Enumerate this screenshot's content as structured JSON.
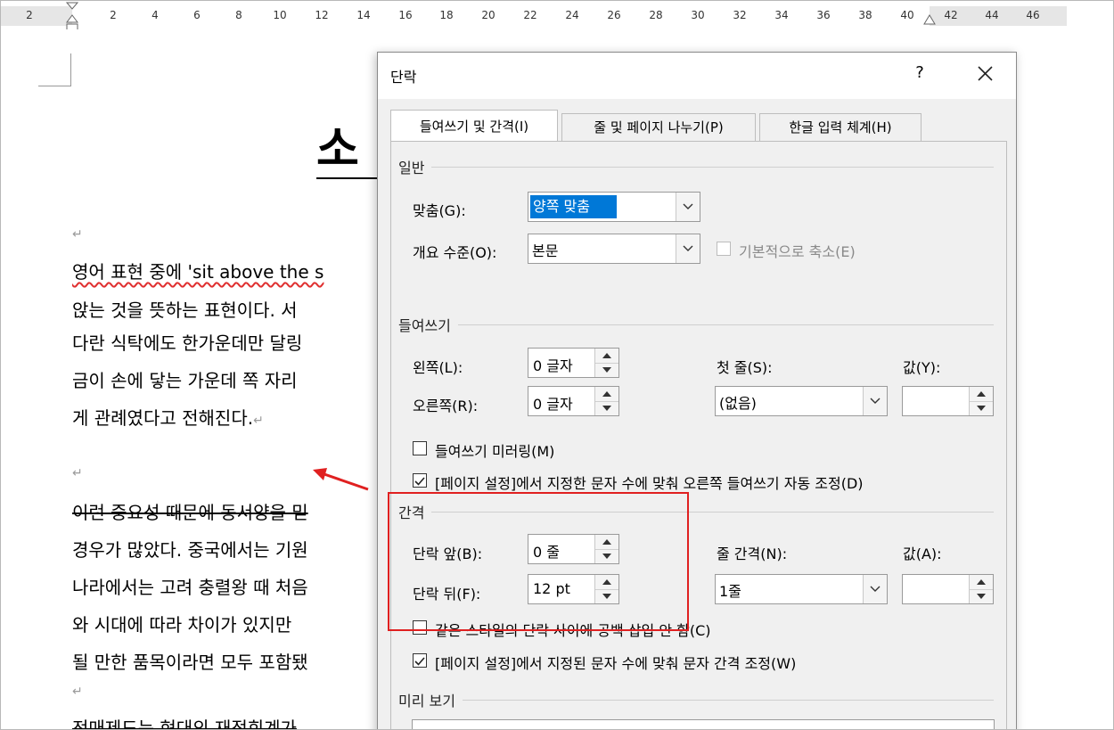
{
  "ruler": {
    "numbers": [
      "2",
      "2",
      "4",
      "6",
      "8",
      "10",
      "12",
      "14",
      "16",
      "18",
      "20",
      "22",
      "24",
      "26",
      "28",
      "30",
      "32",
      "34",
      "36",
      "38",
      "40",
      "42",
      "44",
      "46"
    ]
  },
  "document": {
    "title": "소",
    "lines": [
      "영어 표현 중에 'sit above the s",
      "앉는 것을 뜻하는 표현이다. 서",
      "다란 식탁에도 한가운데만 달링",
      "금이 손에 닿는 가운데 쪽 자리",
      "게 관례였다고 전해진다.",
      "이런 중요성 때문에 동서양을 믿",
      "경우가 많았다. 중국에서는 기원",
      "나라에서는 고려 충렬왕 때 처음",
      "와 시대에 따라 차이가 있지만",
      "될 만한 품목이라면 모두 포함됐",
      "전매제도는 현대의 재정회계가"
    ],
    "para_mark": "↵"
  },
  "dialog": {
    "title": "단락",
    "help": "?",
    "tabs": [
      "들여쓰기 및 간격(I)",
      "줄 및 페이지 나누기(P)",
      "한글 입력 체계(H)"
    ],
    "general": {
      "section": "일반",
      "align_label": "맞춤(G):",
      "align_value": "양쪽 맞춤",
      "outline_label": "개요 수준(O):",
      "outline_value": "본문",
      "collapse_label": "기본적으로 축소(E)"
    },
    "indent": {
      "section": "들여쓰기",
      "left_label": "왼쪽(L):",
      "left_value": "0 글자",
      "right_label": "오른쪽(R):",
      "right_value": "0 글자",
      "first_label": "첫 줄(S):",
      "first_value": "(없음)",
      "by_label": "값(Y):",
      "by_value": "",
      "mirror_label": "들여쓰기 미러링(M)",
      "auto_label": "[페이지 설정]에서 지정한 문자 수에 맞춰 오른쪽 들여쓰기 자동 조정(D)"
    },
    "spacing": {
      "section": "간격",
      "before_label": "단락 앞(B):",
      "before_value": "0 줄",
      "after_label": "단락 뒤(F):",
      "after_value": "12 pt",
      "line_label": "줄 간격(N):",
      "line_value": "1줄",
      "at_label": "값(A):",
      "at_value": "",
      "nospace_label": "같은 스타일의 단락 사이에 공백 삽입 안 함(C)",
      "grid_label": "[페이지 설정]에서 지정된 문자 수에 맞춰 문자 간격 조정(W)"
    },
    "preview": {
      "section": "미리 보기"
    }
  },
  "colors": {
    "accent": "#0078d7",
    "highlight": "#e02020"
  }
}
